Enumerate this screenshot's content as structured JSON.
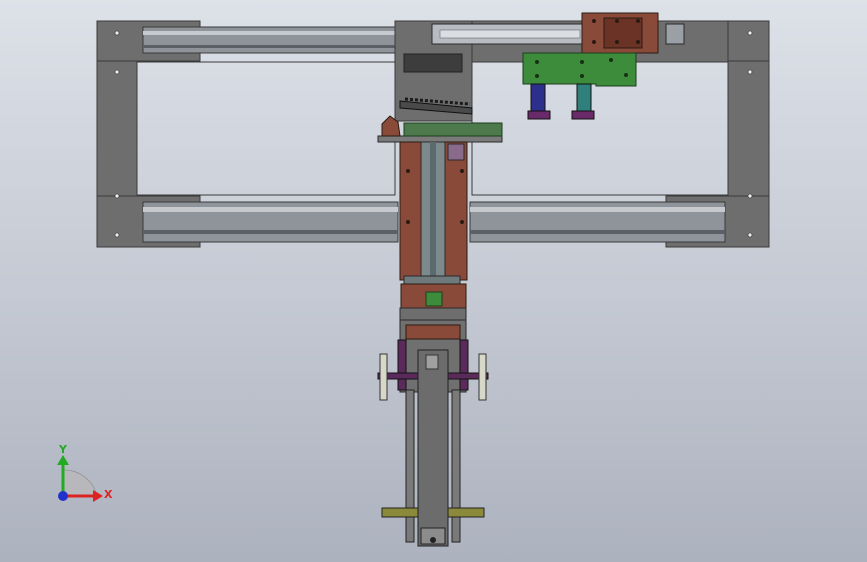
{
  "viewport": {
    "background_top": "#dde1e8",
    "background_bottom": "#acb2be"
  },
  "model": {
    "frame_color": "#6e6e6e",
    "rail_color": "#8f949a",
    "bracket_color": "#8a4a3a",
    "plate_green": "#3c8c3c",
    "cylinder_blue": "#2d2f8c",
    "cylinder_teal": "#2f7f7c",
    "purple_block": "#6a2a6a",
    "olive_bar": "#8a8a3a"
  },
  "triad": {
    "y_label": "Y",
    "x_label": "X",
    "y_color": "#22aa22",
    "x_color": "#dd2222",
    "z_color": "#2233cc"
  }
}
